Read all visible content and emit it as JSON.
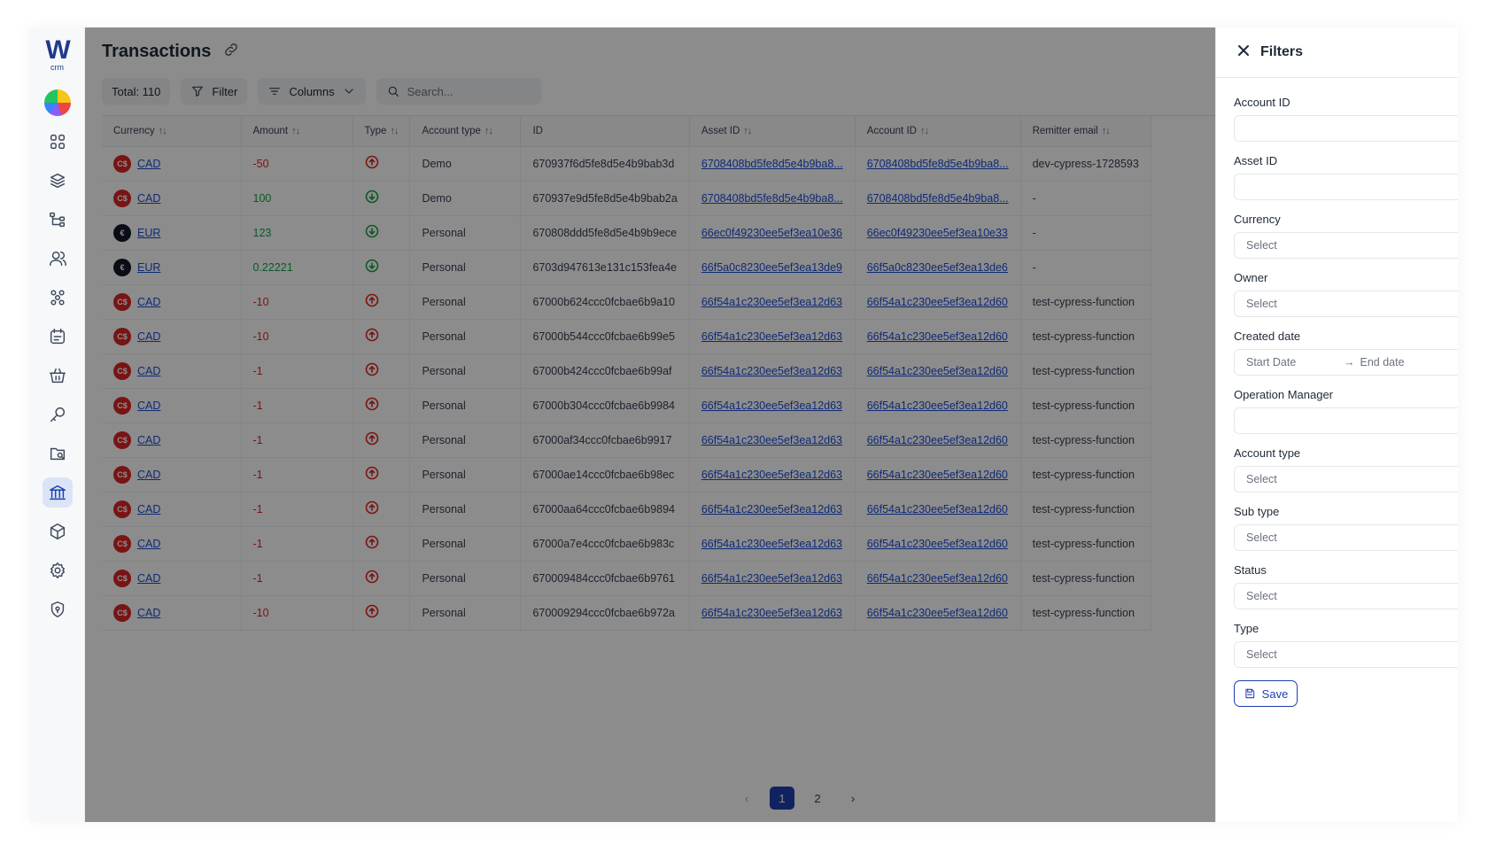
{
  "app": {
    "logo_text": "W",
    "logo_sub": "crm"
  },
  "header": {
    "title": "Transactions"
  },
  "toolbar": {
    "total_label": "Total: 110",
    "filter_label": "Filter",
    "columns_label": "Columns",
    "search_placeholder": "Search..."
  },
  "table": {
    "columns": [
      "Currency",
      "Amount",
      "Type",
      "Account type",
      "ID",
      "Asset ID",
      "Account ID",
      "Remitter email"
    ],
    "rows": [
      {
        "currency": "CAD",
        "amount": "-50",
        "direction": "out",
        "account_type": "Demo",
        "id": "670937f6d5fe8d5e4b9bab3d",
        "asset_id": "6708408bd5fe8d5e4b9ba8...",
        "account_id": "6708408bd5fe8d5e4b9ba8...",
        "email": "dev-cypress-1728593"
      },
      {
        "currency": "CAD",
        "amount": "100",
        "direction": "in",
        "account_type": "Demo",
        "id": "670937e9d5fe8d5e4b9bab2a",
        "asset_id": "6708408bd5fe8d5e4b9ba8...",
        "account_id": "6708408bd5fe8d5e4b9ba8...",
        "email": "-"
      },
      {
        "currency": "EUR",
        "amount": "123",
        "direction": "in",
        "account_type": "Personal",
        "id": "670808ddd5fe8d5e4b9b9ece",
        "asset_id": "66ec0f49230ee5ef3ea10e36",
        "account_id": "66ec0f49230ee5ef3ea10e33",
        "email": "-"
      },
      {
        "currency": "EUR",
        "amount": "0.22221",
        "direction": "in",
        "account_type": "Personal",
        "id": "6703d947613e131c153fea4e",
        "asset_id": "66f5a0c8230ee5ef3ea13de9",
        "account_id": "66f5a0c8230ee5ef3ea13de6",
        "email": "-"
      },
      {
        "currency": "CAD",
        "amount": "-10",
        "direction": "out",
        "account_type": "Personal",
        "id": "67000b624ccc0fcbae6b9a10",
        "asset_id": "66f54a1c230ee5ef3ea12d63",
        "account_id": "66f54a1c230ee5ef3ea12d60",
        "email": "test-cypress-function"
      },
      {
        "currency": "CAD",
        "amount": "-10",
        "direction": "out",
        "account_type": "Personal",
        "id": "67000b544ccc0fcbae6b99e5",
        "asset_id": "66f54a1c230ee5ef3ea12d63",
        "account_id": "66f54a1c230ee5ef3ea12d60",
        "email": "test-cypress-function"
      },
      {
        "currency": "CAD",
        "amount": "-1",
        "direction": "out",
        "account_type": "Personal",
        "id": "67000b424ccc0fcbae6b99af",
        "asset_id": "66f54a1c230ee5ef3ea12d63",
        "account_id": "66f54a1c230ee5ef3ea12d60",
        "email": "test-cypress-function"
      },
      {
        "currency": "CAD",
        "amount": "-1",
        "direction": "out",
        "account_type": "Personal",
        "id": "67000b304ccc0fcbae6b9984",
        "asset_id": "66f54a1c230ee5ef3ea12d63",
        "account_id": "66f54a1c230ee5ef3ea12d60",
        "email": "test-cypress-function"
      },
      {
        "currency": "CAD",
        "amount": "-1",
        "direction": "out",
        "account_type": "Personal",
        "id": "67000af34ccc0fcbae6b9917",
        "asset_id": "66f54a1c230ee5ef3ea12d63",
        "account_id": "66f54a1c230ee5ef3ea12d60",
        "email": "test-cypress-function"
      },
      {
        "currency": "CAD",
        "amount": "-1",
        "direction": "out",
        "account_type": "Personal",
        "id": "67000ae14ccc0fcbae6b98ec",
        "asset_id": "66f54a1c230ee5ef3ea12d63",
        "account_id": "66f54a1c230ee5ef3ea12d60",
        "email": "test-cypress-function"
      },
      {
        "currency": "CAD",
        "amount": "-1",
        "direction": "out",
        "account_type": "Personal",
        "id": "67000aa64ccc0fcbae6b9894",
        "asset_id": "66f54a1c230ee5ef3ea12d63",
        "account_id": "66f54a1c230ee5ef3ea12d60",
        "email": "test-cypress-function"
      },
      {
        "currency": "CAD",
        "amount": "-1",
        "direction": "out",
        "account_type": "Personal",
        "id": "67000a7e4ccc0fcbae6b983c",
        "asset_id": "66f54a1c230ee5ef3ea12d63",
        "account_id": "66f54a1c230ee5ef3ea12d60",
        "email": "test-cypress-function"
      },
      {
        "currency": "CAD",
        "amount": "-1",
        "direction": "out",
        "account_type": "Personal",
        "id": "670009484ccc0fcbae6b9761",
        "asset_id": "66f54a1c230ee5ef3ea12d63",
        "account_id": "66f54a1c230ee5ef3ea12d60",
        "email": "test-cypress-function"
      },
      {
        "currency": "CAD",
        "amount": "-10",
        "direction": "out",
        "account_type": "Personal",
        "id": "670009294ccc0fcbae6b972a",
        "asset_id": "66f54a1c230ee5ef3ea12d63",
        "account_id": "66f54a1c230ee5ef3ea12d60",
        "email": "test-cypress-function"
      }
    ]
  },
  "pagination": {
    "pages": [
      "1",
      "2"
    ],
    "current": "1"
  },
  "filters": {
    "title": "Filters",
    "account_id_label": "Account ID",
    "asset_id_label": "Asset ID",
    "currency_label": "Currency",
    "owner_label": "Owner",
    "created_date_label": "Created date",
    "start_date_placeholder": "Start Date",
    "date_arrow": "→",
    "end_date_placeholder": "End date",
    "operation_manager_label": "Operation Manager",
    "account_type_label": "Account type",
    "sub_type_label": "Sub type",
    "status_label": "Status",
    "type_label": "Type",
    "select_placeholder": "Select",
    "save_label": "Save"
  },
  "colors": {
    "accent": "#1e40af",
    "negative": "#dc2626",
    "positive": "#16a34a",
    "cad_badge": "#dc2626",
    "eur_badge": "#111827"
  },
  "icons": {
    "cad": "C$",
    "eur": "€"
  }
}
